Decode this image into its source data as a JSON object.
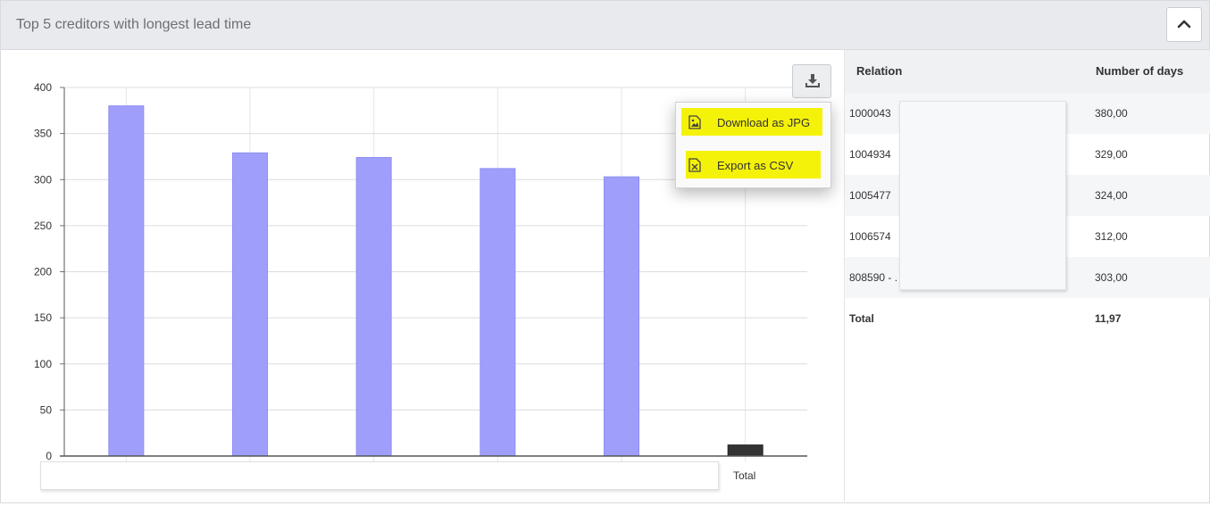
{
  "header": {
    "title": "Top 5 creditors with longest lead time"
  },
  "colors": {
    "bar": "#9f9ffb",
    "total_bar": "#333333",
    "highlight": "#f5f20a"
  },
  "icons": {
    "collapse": "chevron-up-icon",
    "export": "download-icon",
    "jpg": "image-file-icon",
    "csv": "excel-file-icon"
  },
  "export_menu": {
    "download_jpg": "Download as JPG",
    "export_csv": "Export as CSV"
  },
  "chart_data": {
    "type": "bar",
    "categories": [
      "",
      "",
      "",
      "",
      "",
      "Total"
    ],
    "values": [
      380,
      329,
      324,
      312,
      303,
      11.97
    ],
    "yticks": [
      0,
      50,
      100,
      150,
      200,
      250,
      300,
      350,
      400
    ],
    "ylim": [
      0,
      400
    ],
    "title": "",
    "xlabel": "",
    "ylabel": "",
    "grid": true
  },
  "table": {
    "headers": {
      "relation": "Relation",
      "days": "Number of days"
    },
    "rows": [
      {
        "relation": "1000043",
        "days": "380,00"
      },
      {
        "relation": "1004934",
        "days": "329,00"
      },
      {
        "relation": "1005477",
        "days": "324,00"
      },
      {
        "relation": "1006574",
        "days": "312,00"
      },
      {
        "relation": "808590 - .",
        "days": "303,00"
      }
    ],
    "total": {
      "label": "Total",
      "days": "11,97"
    }
  }
}
